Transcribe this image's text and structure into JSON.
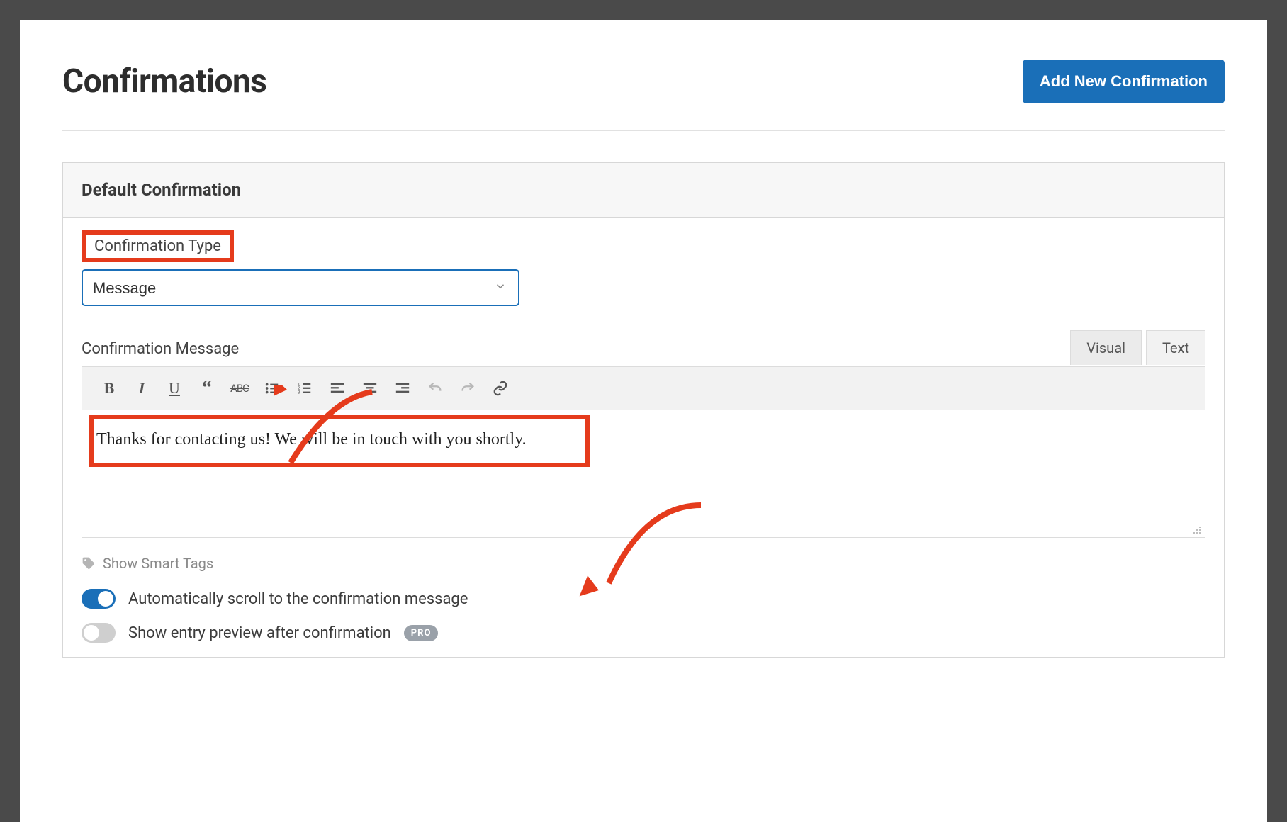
{
  "header": {
    "title": "Confirmations",
    "add_button": "Add New Confirmation"
  },
  "panel": {
    "title": "Default Confirmation"
  },
  "form": {
    "type_label": "Confirmation Type",
    "type_value": "Message",
    "message_label": "Confirmation Message",
    "message_value": "Thanks for contacting us! We will be in touch with you shortly."
  },
  "tabs": {
    "visual": "Visual",
    "text": "Text"
  },
  "toolbar_icons": {
    "bold": "bold-icon",
    "italic": "italic-icon",
    "underline": "underline-icon",
    "quote": "quote-icon",
    "strike": "strikethrough-icon",
    "ul": "bullet-list-icon",
    "ol": "numbered-list-icon",
    "align_left": "align-left-icon",
    "align_center": "align-center-icon",
    "align_right": "align-right-icon",
    "undo": "undo-icon",
    "redo": "redo-icon",
    "link": "link-icon"
  },
  "smart_tags_label": "Show Smart Tags",
  "options": {
    "auto_scroll": {
      "label": "Automatically scroll to the confirmation message",
      "enabled": true
    },
    "entry_preview": {
      "label": "Show entry preview after confirmation",
      "enabled": false,
      "pro": "PRO"
    }
  },
  "annotation_color": "#e53b1c"
}
